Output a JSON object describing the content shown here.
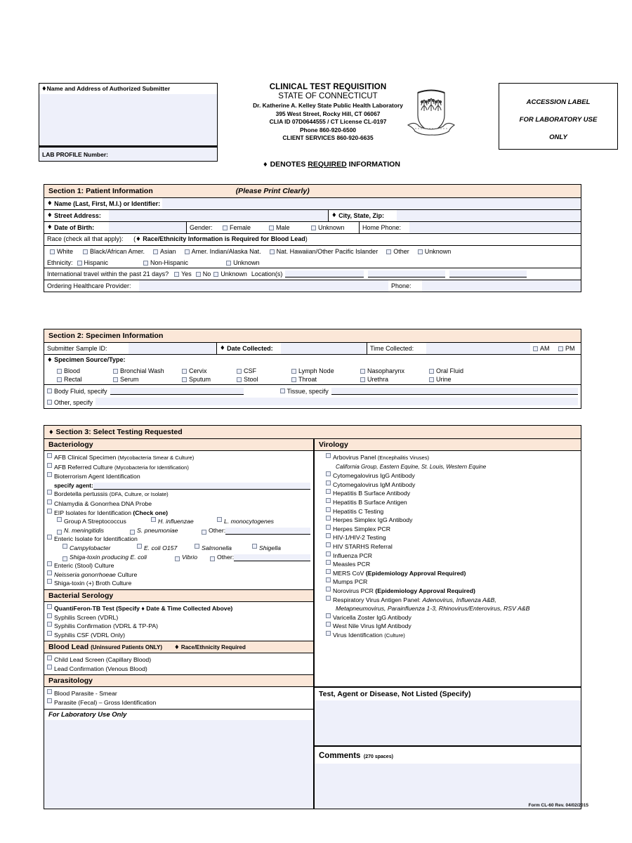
{
  "header": {
    "submitter_label": "Name and Address of Authorized Submitter",
    "lab_profile_label": "LAB PROFILE Number:",
    "title1": "CLINICAL TEST REQUISITION",
    "title2": "STATE OF CONNECTICUT",
    "lab_name": "Dr. Katherine A. Kelley State Public Health Laboratory",
    "address": "395 West Street, Rocky Hill, CT 06067",
    "clia": "CLIA ID 07D0644555 / CT License CL-0197",
    "phone": "Phone 860-920-6500",
    "client_services": "CLIENT SERVICES 860-920-6635",
    "denotes_pre": "DENOTES ",
    "denotes_u": "REQUIRED",
    "denotes_post": " INFORMATION",
    "accession_l1": "ACCESSION LABEL",
    "accession_l2": "FOR LABORATORY USE",
    "accession_l3": "ONLY",
    "seal_icon": "connecticut-state-seal-icon"
  },
  "section1": {
    "title": "Section 1: Patient Information",
    "note": "(Please Print Clearly)",
    "name_label": "Name (Last, First, M.I.) or Identifier:",
    "street_label": "Street Address:",
    "city_label": "City, State, Zip:",
    "dob_label": "Date of Birth:",
    "gender_label": "Gender:",
    "gender_options": [
      "Female",
      "Male",
      "Unknown"
    ],
    "home_phone_label": "Home Phone:",
    "race_label": "Race (check all that apply):",
    "race_note": "Race/Ethnicity Information is Required for Blood Lead",
    "race_options": [
      "White",
      "Black/African Amer.",
      "Asian",
      "Amer. Indian/Alaska Nat.",
      "Nat. Hawaiian/Other Pacific Islander",
      "Other",
      "Unknown"
    ],
    "ethnicity_label": "Ethnicity:",
    "ethnicity_options": [
      "Hispanic",
      "Non-Hispanic",
      "Unknown"
    ],
    "travel_label": "International travel within the past 21 days?",
    "travel_options": [
      "Yes",
      "No",
      "Unknown"
    ],
    "locations_label": "Location(s)",
    "provider_label": "Ordering Healthcare Provider:",
    "provider_phone_label": "Phone:"
  },
  "section2": {
    "title": "Section 2: Specimen Information",
    "sample_id_label": "Submitter Sample ID:",
    "date_collected_label": "Date Collected:",
    "time_collected_label": "Time Collected:",
    "am_label": "AM",
    "pm_label": "PM",
    "source_label": "Specimen Source/Type:",
    "sources_row1": [
      "Blood",
      "Bronchial Wash",
      "Cervix",
      "CSF",
      "Lymph Node",
      "Nasopharynx",
      "Oral Fluid"
    ],
    "sources_row2": [
      "Rectal",
      "Serum",
      "Sputum",
      "Stool",
      "Throat",
      "Urethra",
      "Urine"
    ],
    "body_fluid_label": "Body Fluid, specify",
    "tissue_label": "Tissue, specify",
    "other_label": "Other, specify"
  },
  "section3": {
    "title": "Section 3: Select Testing Requested",
    "bacteriology": {
      "heading": "Bacteriology",
      "items": [
        {
          "text": "AFB Clinical Specimen ",
          "paren": "(Mycobacteria Smear & Culture)"
        },
        {
          "text": "AFB Referred Culture ",
          "paren": "(Mycobacteria for Identification)"
        },
        {
          "text": "Bioterrorism Agent Identification",
          "paren": ""
        },
        {
          "text": "Bordetella pertussis ",
          "paren": "(DFA, Culture, or Isolate)"
        },
        {
          "text": "Chlamydia & Gonorrhea DNA Probe",
          "paren": ""
        },
        {
          "text": "EIP Isolates for Identification ",
          "bold_suffix": "(Check one)"
        },
        {
          "text": "Enteric Isolate for Identification",
          "paren": ""
        },
        {
          "text": "Enteric (Stool) Culture",
          "paren": ""
        },
        {
          "text": "Neisseria gonorrhoeae Culture",
          "paren": "",
          "italic_prefix": "Neisseria gonorrhoeae",
          "plain_suffix": " Culture"
        },
        {
          "text": "Shiga-toxin (+) Broth Culture",
          "paren": ""
        }
      ],
      "specify_agent_label": "specify agent:",
      "eip_row1": [
        "Group A Streptococcus",
        "H. influenzae",
        "L. monocytogenes"
      ],
      "eip_row2": [
        "N. meningitidis",
        "S. pneumoniae"
      ],
      "eip_other_label": "Other:",
      "enteric_row1": [
        "Campylobacter",
        "E. coli O157",
        "Salmonella",
        "Shigella"
      ],
      "enteric_row2": [
        "Shiga-toxin producing E. coli",
        "Vibrio"
      ],
      "enteric_other_label": "Other:"
    },
    "bacterial_serology": {
      "heading": "Bacterial Serology",
      "items": [
        "QuantiFeron-TB Test (Specify ♦ Date & Time Collected Above)",
        "Syphilis Screen (VDRL)",
        "Syphilis Confirmation (VDRL & TP-PA)",
        "Syphilis CSF (VDRL Only)"
      ]
    },
    "blood_lead": {
      "heading": "Blood Lead",
      "heading_note": "(Uninsured Patients ONLY)",
      "heading_req": "Race/Ethnicity Required",
      "items": [
        "Child Lead Screen (Capillary Blood)",
        "Lead Confirmation (Venous Blood)"
      ]
    },
    "parasitology": {
      "heading": "Parasitology",
      "items": [
        "Blood Parasite - Smear",
        "Parasite (Fecal) – Gross Identification"
      ]
    },
    "lab_use": {
      "heading": "For Laboratory Use Only"
    },
    "virology": {
      "heading": "Virology",
      "arbovirus": "Arbovirus Panel ",
      "arbovirus_paren": "(Encephalitis Viruses)",
      "arbovirus_sub": "California Group, Eastern Equine, St. Louis, Western Equine",
      "items": [
        "Cytomegalovirus IgG Antibody",
        "Cytomegalovirus IgM Antibody",
        "Hepatitis B Surface Antibody",
        "Hepatitis B Surface Antigen",
        "Hepatitis C Testing",
        "Herpes Simplex IgG Antibody",
        "Herpes Simplex PCR",
        "HIV-1/HIV-2 Testing",
        "HIV STARHS Referral",
        "Influenza PCR",
        "Measles PCR"
      ],
      "mers": "MERS CoV ",
      "mers_bold": "(Epidemiology Approval Required)",
      "mumps": "Mumps PCR",
      "noro": "Norovirus PCR ",
      "noro_bold": "(Epidemiology Approval Required)",
      "resp": "Respiratory Virus Antigen Panel: ",
      "resp_it1": "Adenovirus, Influenza A&B,",
      "resp_it2": "Metapneumovirus, Parainfluenza 1-3, Rhinovirus/Enterovirus, RSV A&B",
      "tail_items": [
        "Varicella Zoster IgG Antibody",
        "West Nile Virus IgM Antibody"
      ],
      "virus_id": "Virus Identification ",
      "virus_id_paren": "(Culture)"
    },
    "not_listed": {
      "heading": "Test, Agent or Disease, Not Listed (Specify)"
    },
    "comments": {
      "heading": "Comments",
      "note": "(270 spaces)"
    }
  },
  "footer": {
    "form_id": "Form CL-60 Rev. 04/02/2015"
  },
  "colors": {
    "section_header_bg": "#fbe7d8",
    "field_fill": "#eef0fa",
    "border": "#000000",
    "checkbox_border": "#7b8699"
  }
}
